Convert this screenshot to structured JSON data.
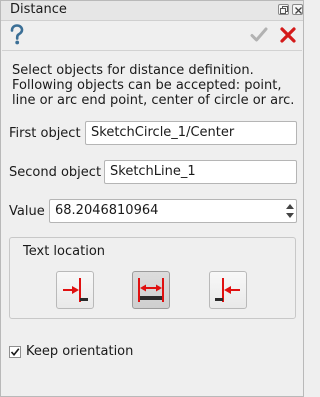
{
  "window": {
    "title": "Distance"
  },
  "toolbar": {
    "help_icon": "help-question-icon",
    "ok_icon": "check-icon",
    "cancel_icon": "cancel-x-icon"
  },
  "description": {
    "line1": "Select objects for distance definition.",
    "line2": "Following objects can be accepted: point,",
    "line3": "line or arc end point, center of circle or arc."
  },
  "form": {
    "first_object_label": "First object",
    "first_object_value": "SketchCircle_1/Center",
    "second_object_label": "Second object",
    "second_object_value": "SketchLine_1",
    "value_label": "Value",
    "value_value": "68.2046810964"
  },
  "text_location": {
    "title": "Text location",
    "options": [
      "left",
      "center",
      "right"
    ],
    "selected": "center"
  },
  "keep_orientation": {
    "label": "Keep orientation",
    "checked": true
  },
  "colors": {
    "arrow_red": "#e01010",
    "line_dark": "#1a1a1a",
    "dim_blue": "#2a6f8a"
  }
}
